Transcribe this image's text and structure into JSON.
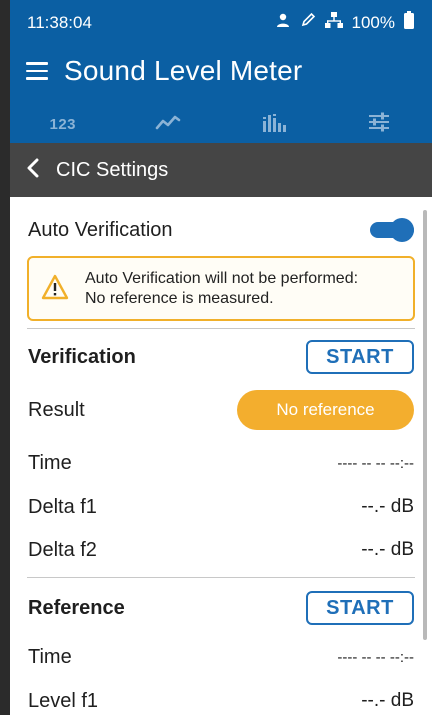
{
  "status": {
    "time": "11:38:04",
    "battery": "100%"
  },
  "app": {
    "title": "Sound Level Meter"
  },
  "tabs": [
    {
      "label": "123"
    }
  ],
  "subheader": {
    "title": "CIC Settings"
  },
  "auto_verification": {
    "label": "Auto Verification",
    "enabled": true,
    "warning_line1": "Auto Verification will not be performed:",
    "warning_line2": "No reference is measured."
  },
  "verification": {
    "title": "Verification",
    "start_label": "START",
    "result_label": "Result",
    "result_value": "No reference",
    "time_label": "Time",
    "time_value": "---- -- --  --:--",
    "delta_f1_label": "Delta f1",
    "delta_f1_value": "--.- dB",
    "delta_f2_label": "Delta f2",
    "delta_f2_value": "--.- dB"
  },
  "reference": {
    "title": "Reference",
    "start_label": "START",
    "time_label": "Time",
    "time_value": "---- -- --  --:--",
    "level_f1_label": "Level f1",
    "level_f1_value": "--.- dB"
  },
  "colors": {
    "header": "#0b5fa3",
    "subheader": "#454545",
    "accent": "#1f6fb8",
    "warning": "#f1b02a",
    "pill": "#f3ae2e"
  }
}
